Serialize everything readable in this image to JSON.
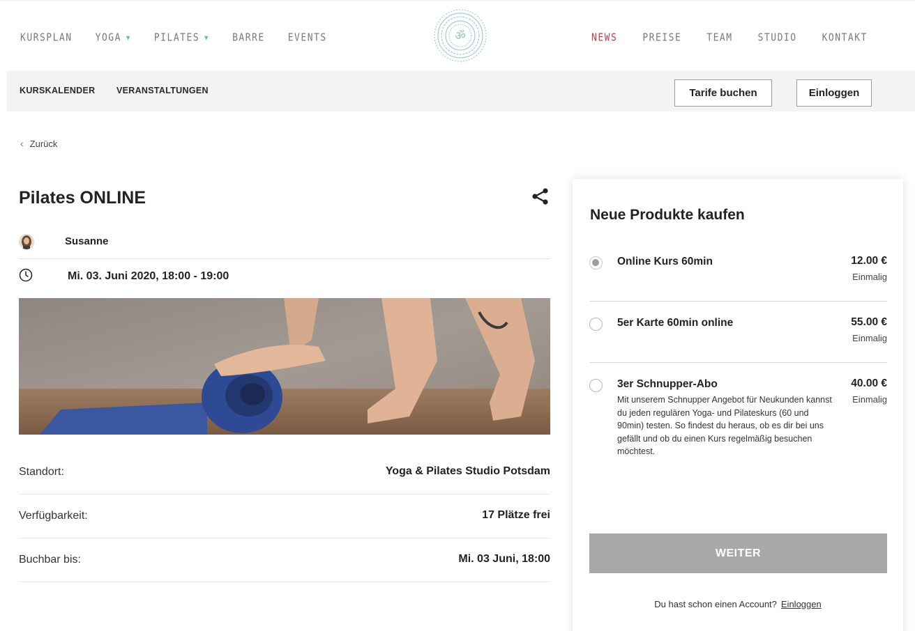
{
  "nav": {
    "left": [
      {
        "label": "KURSPLAN",
        "dropdown": false
      },
      {
        "label": "YOGA",
        "dropdown": true
      },
      {
        "label": "PILATES",
        "dropdown": true
      },
      {
        "label": "BARRE",
        "dropdown": false
      },
      {
        "label": "EVENTS",
        "dropdown": false
      }
    ],
    "right": [
      {
        "label": "NEWS",
        "active": true
      },
      {
        "label": "PREISE",
        "active": false
      },
      {
        "label": "TEAM",
        "active": false
      },
      {
        "label": "STUDIO",
        "active": false
      },
      {
        "label": "KONTAKT",
        "active": false
      }
    ],
    "logo_icon": "om-mandala-icon",
    "active_color": "#c73a45",
    "caret_color": "#6fb8b3"
  },
  "subnav": {
    "kurskalender": "KURSKALENDER",
    "veranstaltungen": "VERANSTALTUNGEN",
    "tarife": "Tarife buchen",
    "einloggen": "Einloggen"
  },
  "back": "Zurück",
  "course": {
    "title": "Pilates ONLINE",
    "teacher": "Susanne",
    "datetime": "Mi. 03. Juni 2020, 18:00 - 19:00",
    "details": [
      {
        "label": "Standort:",
        "value": "Yoga & Pilates Studio Potsdam"
      },
      {
        "label": "Verfügbarkeit:",
        "value": "17 Plätze frei"
      },
      {
        "label": "Buchbar bis:",
        "value": "Mi. 03 Juni, 18:00"
      }
    ]
  },
  "panel": {
    "title": "Neue Produkte kaufen",
    "products": [
      {
        "name": "Online Kurs 60min",
        "price": "12.00 €",
        "freq": "Einmalig",
        "selected": true,
        "desc": ""
      },
      {
        "name": "5er Karte 60min online",
        "price": "55.00 €",
        "freq": "Einmalig",
        "selected": false,
        "desc": ""
      },
      {
        "name": "3er Schnupper-Abo",
        "price": "40.00 €",
        "freq": "Einmalig",
        "selected": false,
        "desc": "Mit unserem Schnupper Angebot für Neukunden kannst du jeden regulären Yoga- und Pilateskurs (60 und 90min) testen. So findest du heraus, ob es dir bei uns gefällt und ob du einen Kurs regelmäßig besuchen möchtest."
      }
    ],
    "weiter": "WEITER",
    "account_text": "Du hast schon einen Account?",
    "account_link": "Einloggen"
  }
}
